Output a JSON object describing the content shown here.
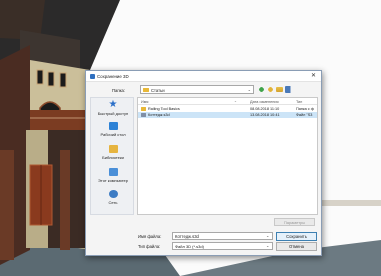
{
  "dialog": {
    "title": "Сохранение 3D",
    "close_glyph": "✕",
    "lookin_label": "Папка:",
    "lookin_value": "Статьи",
    "chevron_glyph": "⌄",
    "places": [
      {
        "label": "Быстрый доступ",
        "icon": "star-icon"
      },
      {
        "label": "Рабочий стол",
        "icon": "desktop-icon"
      },
      {
        "label": "Библиотеки",
        "icon": "libraries-icon"
      },
      {
        "label": "Этот компьютер",
        "icon": "computer-icon"
      },
      {
        "label": "Сеть",
        "icon": "network-icon"
      }
    ],
    "columns": {
      "name": "Имя",
      "date": "Дата изменения",
      "type": "Тип"
    },
    "files": [
      {
        "name": "Railing Tool Basics",
        "date": "08.08.2018 11:10",
        "type": "Папка с ф",
        "icon": "folder-icon"
      },
      {
        "name": "Коттедж.s3d",
        "date": "13.08.2018 10:41",
        "type": "Файл \"S3",
        "icon": "file-icon"
      }
    ],
    "params_button": "Параметры",
    "filename_label": "Имя файла:",
    "filename_value": "Коттедж.s3d",
    "save_button": "Сохранить",
    "filetype_label": "Тип файла:",
    "filetype_value": "Файл 3D (*.s3d)",
    "cancel_button": "Отмена"
  },
  "colors": {
    "accent": "#3c7fb1",
    "selection": "#cce4f7",
    "folder": "#e8b838"
  }
}
